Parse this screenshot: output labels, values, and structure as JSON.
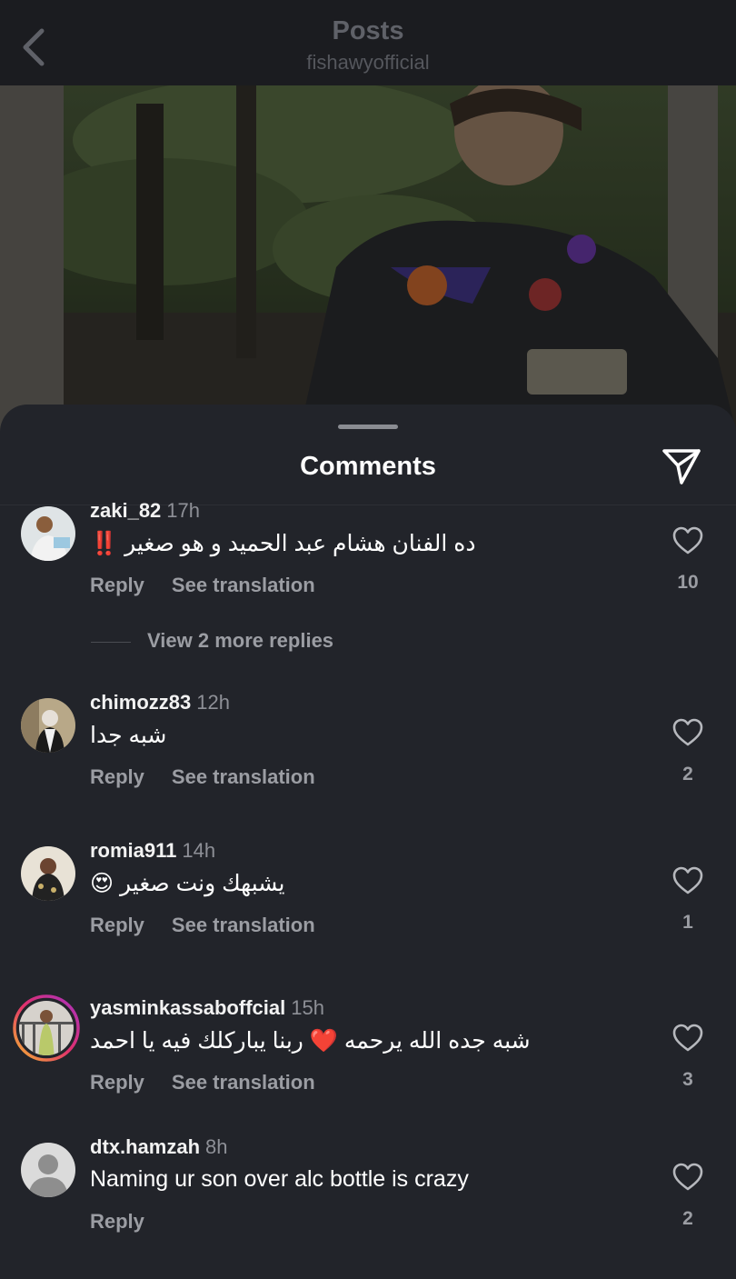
{
  "header": {
    "title": "Posts",
    "subtitle": "fishawyofficial",
    "back_icon": "chevron-left-icon"
  },
  "sheet": {
    "title": "Comments",
    "share_icon": "send-icon"
  },
  "comments": [
    {
      "username": "zaki_82",
      "time": "17h",
      "text": "ده الفنان هشام عبد الحميد و هو صغير",
      "emoji": "‼️",
      "reply": "Reply",
      "translate": "See translation",
      "likes": "10"
    },
    {
      "username": "chimozz83",
      "time": "12h",
      "text": "شبه جدا",
      "reply": "Reply",
      "translate": "See translation",
      "likes": "2"
    },
    {
      "username": "romia911",
      "time": "14h",
      "text": "يشبهك ونت صغير",
      "emoji": "😍",
      "reply": "Reply",
      "translate": "See translation",
      "likes": "1"
    },
    {
      "username": "yasminkassaboffcial",
      "time": "15h",
      "text": "شبه جده الله يرحمه ❤️ ربنا يباركلك فيه يا احمد",
      "reply": "Reply",
      "translate": "See translation",
      "likes": "3"
    },
    {
      "username": "dtx.hamzah",
      "time": "8h",
      "text": "Naming ur son over alc bottle is crazy",
      "reply": "Reply",
      "likes": "2"
    }
  ],
  "view_replies": "View 2 more replies",
  "colors": {
    "background": "#22242a",
    "header": "#1b1c20",
    "muted": "#9b9da3",
    "story_ring": "#e1306c"
  }
}
